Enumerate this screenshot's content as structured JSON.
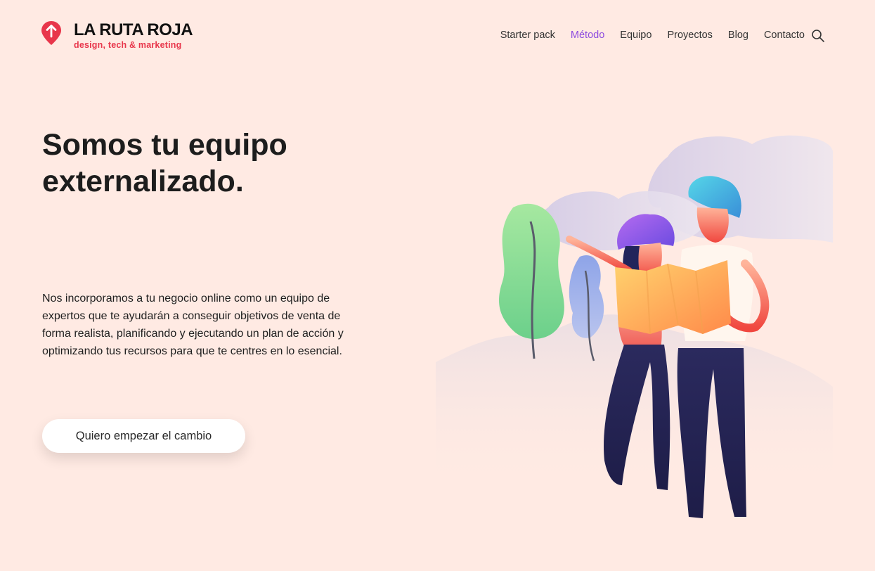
{
  "brand": {
    "title": "LA RUTA ROJA",
    "subtitle": "design, tech & marketing",
    "accent": "#E8364B"
  },
  "nav": {
    "items": [
      {
        "label": "Starter pack",
        "active": false
      },
      {
        "label": "Método",
        "active": true
      },
      {
        "label": "Equipo",
        "active": false
      },
      {
        "label": "Proyectos",
        "active": false
      },
      {
        "label": "Blog",
        "active": false
      },
      {
        "label": "Contacto",
        "active": false
      }
    ],
    "active_color": "#8D4BE0",
    "search_icon": "search-icon"
  },
  "hero": {
    "title_line1": "Somos tu equipo",
    "title_line2": "externalizado.",
    "description": "Nos incorporamos a tu negocio online como un equipo de expertos que te ayudarán a conseguir objetivos de venta de forma realista, planificando y ejecutando un plan de acción y optimizando tus recursos para que te centres en lo esencial.",
    "cta_label": "Quiero empezar el cambio"
  },
  "colors": {
    "background": "#FFEAE3",
    "button_bg": "#FFFFFF"
  }
}
